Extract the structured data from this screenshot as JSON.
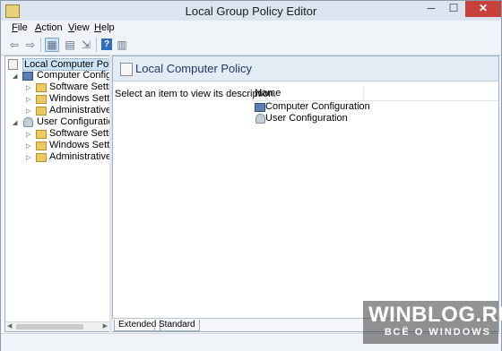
{
  "window": {
    "title": "Local Group Policy Editor",
    "min_glyph": "─",
    "max_glyph": "☐",
    "close_glyph": "✕"
  },
  "menu": [
    {
      "accel": "F",
      "rest": "ile"
    },
    {
      "accel": "A",
      "rest": "ction"
    },
    {
      "accel": "V",
      "rest": "iew"
    },
    {
      "accel": "H",
      "rest": "elp"
    }
  ],
  "toolbar": {
    "back_glyph": "⇦",
    "forward_glyph": "⇨",
    "show_hide_tree_glyph": "▦",
    "properties_glyph": "▤",
    "export_glyph": "⇲",
    "help_glyph": "?",
    "view_glyph": "▥"
  },
  "tree": {
    "root": "Local Computer Policy",
    "computer_config": "Computer Configura",
    "computer_children": [
      "Software Settings",
      "Windows Setting",
      "Administrative Te"
    ],
    "user_config": "User Configuration",
    "user_children": [
      "Software Settings",
      "Windows Setting",
      "Administrative Te"
    ],
    "expand_glyph": "◢",
    "collapse_glyph": "▷"
  },
  "right_pane": {
    "header": "Local Computer Policy",
    "description": "Select an item to view its description.",
    "column_name": "Name",
    "items": [
      "Computer Configuration",
      "User Configuration"
    ]
  },
  "tabs": [
    "Extended",
    "Standard"
  ],
  "watermark": {
    "line1": "WINBLOG.RU",
    "line2": "ВСЁ О WINDOWS"
  },
  "colors": {
    "titlebar": "#dbe4ef",
    "close_button": "#c7423b",
    "selection": "#cce4f7",
    "header_band": "#e3ebf4"
  }
}
